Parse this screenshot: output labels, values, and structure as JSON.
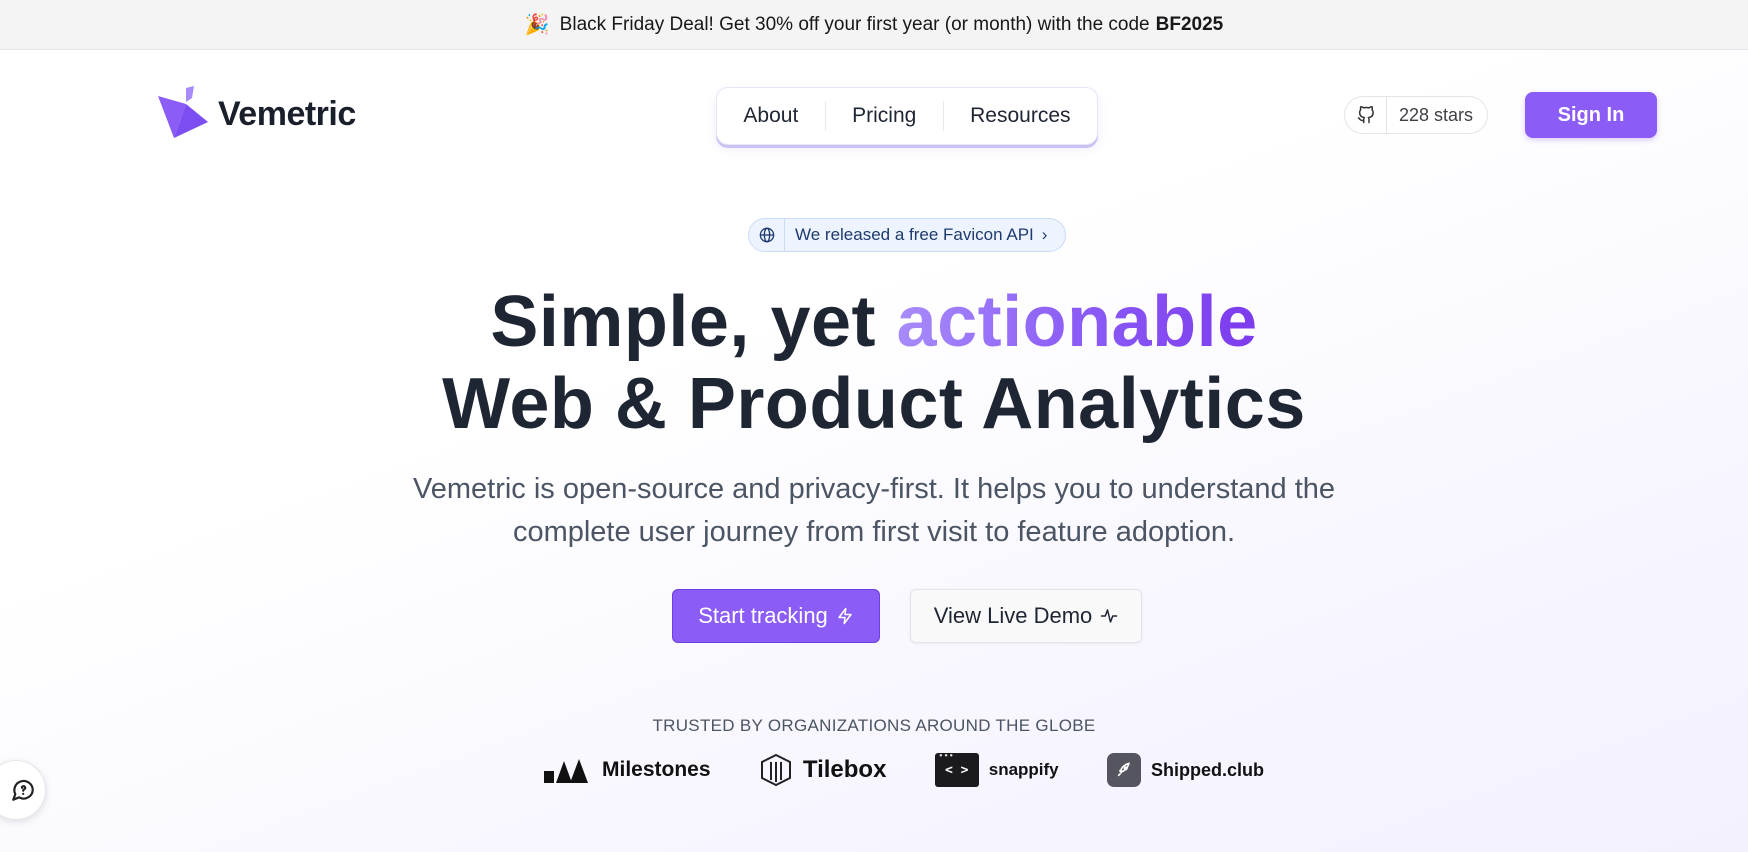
{
  "banner": {
    "emoji": "🎉",
    "text": "Black Friday Deal! Get 30% off your first year (or month) with the code",
    "code": "BF2025"
  },
  "header": {
    "logo_text": "Vemetric",
    "nav": [
      {
        "label": "About"
      },
      {
        "label": "Pricing"
      },
      {
        "label": "Resources"
      }
    ],
    "github_stars": "228 stars",
    "signin_label": "Sign In"
  },
  "announcement": {
    "icon": "globe-icon",
    "text": "We released a free Favicon API",
    "chevron": "›"
  },
  "hero": {
    "line1_plain": "Simple, yet",
    "line1_accent": "actionable",
    "line2": "Web & Product Analytics",
    "subtitle": "Vemetric is open-source and privacy-first. It helps you to understand the complete user journey from first visit to feature adoption.",
    "cta_primary": "Start tracking",
    "cta_secondary": "View Live Demo"
  },
  "trusted": {
    "heading": "TRUSTED BY ORGANIZATIONS AROUND THE GLOBE",
    "logos": [
      {
        "name": "Milestones"
      },
      {
        "name": "Tilebox"
      },
      {
        "name": "snappify",
        "badge": "< >"
      },
      {
        "name": "Shipped.club"
      }
    ]
  },
  "colors": {
    "accent": "#8b5cf6",
    "text": "#1e2533",
    "muted": "#4b5563"
  }
}
